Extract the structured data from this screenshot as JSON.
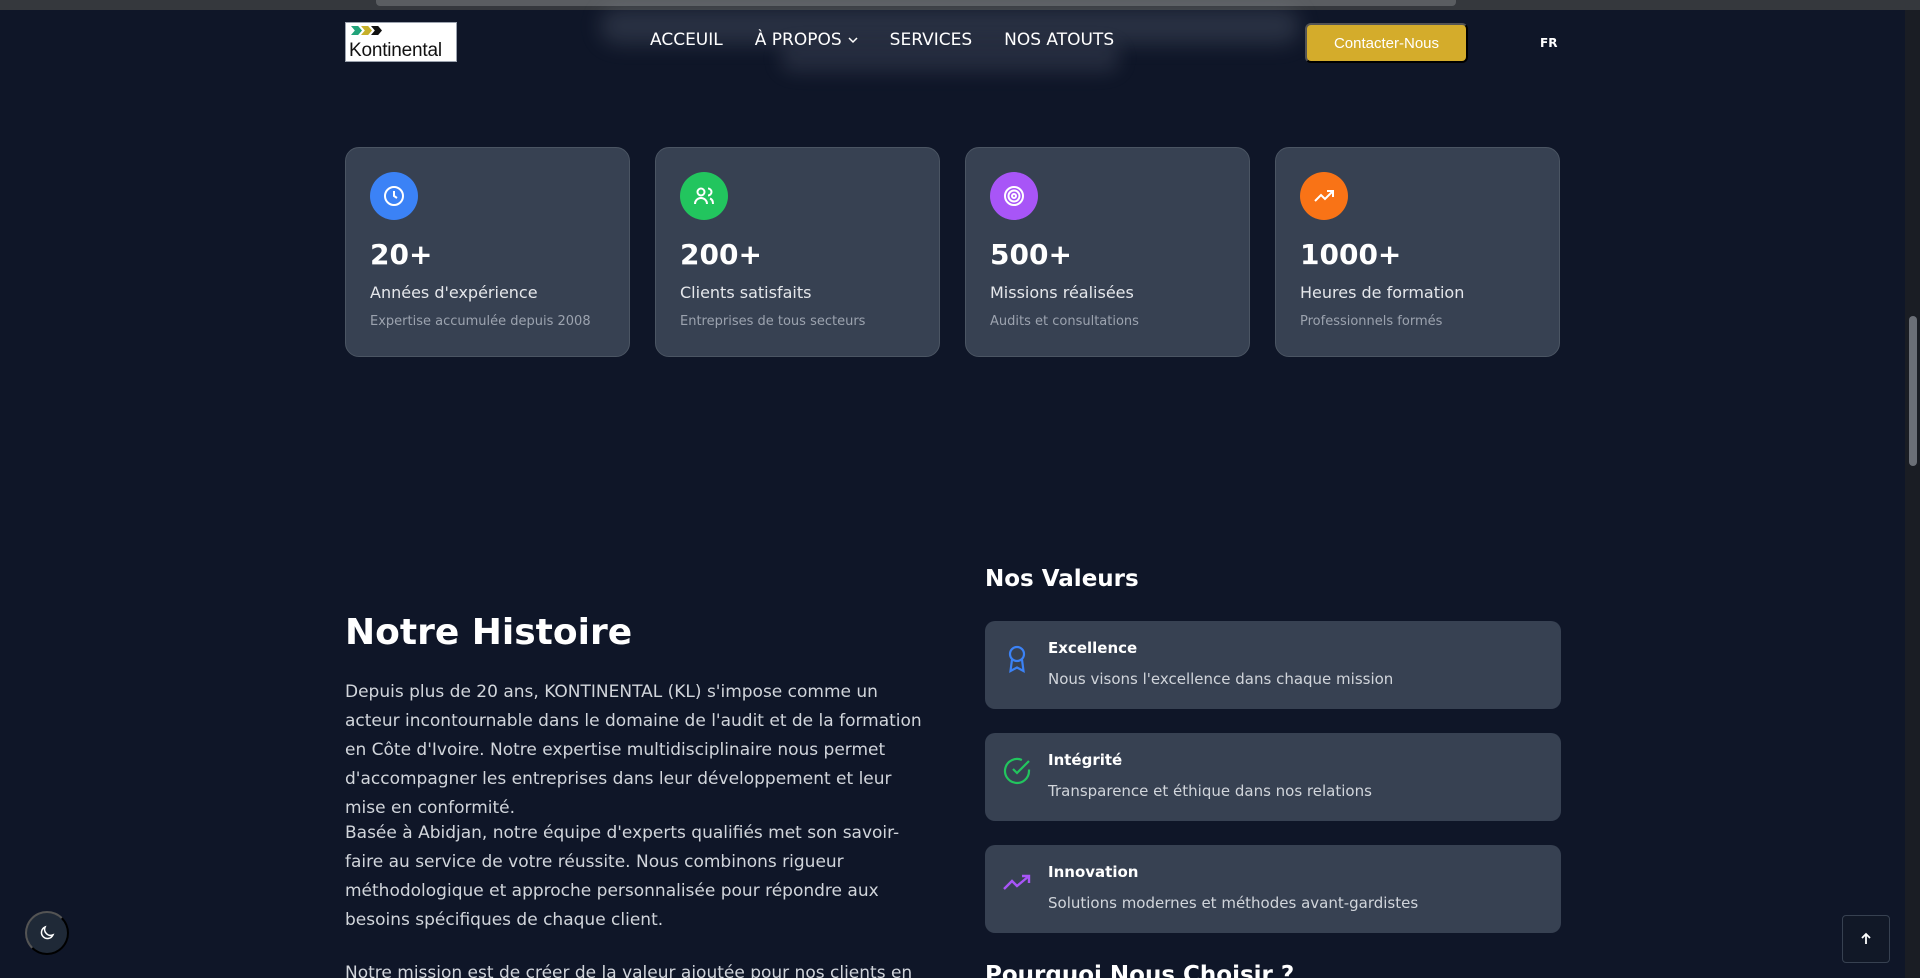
{
  "header": {
    "logo_text": "Kontinental",
    "nav": {
      "accueil": "ACCEUIL",
      "apropos": "À PROPOS",
      "services": "SERVICES",
      "atouts": "NOS ATOUTS"
    },
    "cta_label": "Contacter-Nous",
    "language": "FR"
  },
  "stats": [
    {
      "value": "20+",
      "label": "Années d'expérience",
      "sub": "Expertise accumulée depuis 2008",
      "icon": "clock-icon",
      "color": "#3b82f6"
    },
    {
      "value": "200+",
      "label": "Clients satisfaits",
      "sub": "Entreprises de tous secteurs",
      "icon": "users-icon",
      "color": "#22c55e"
    },
    {
      "value": "500+",
      "label": "Missions réalisées",
      "sub": "Audits et consultations",
      "icon": "target-icon",
      "color": "#a855f7"
    },
    {
      "value": "1000+",
      "label": "Heures de formation",
      "sub": "Professionnels formés",
      "icon": "trending-up-icon",
      "color": "#f97316"
    }
  ],
  "history": {
    "title": "Notre Histoire",
    "paragraphs": [
      "Depuis plus de 20 ans, KONTINENTAL (KL) s'impose comme un acteur incontournable dans le domaine de l'audit et de la formation en Côte d'Ivoire. Notre expertise multidisciplinaire nous permet d'accompagner les entreprises dans leur développement et leur mise en conformité.",
      "Basée à Abidjan, notre équipe d'experts qualifiés met son savoir-faire au service de votre réussite. Nous combinons rigueur méthodologique et approche personnalisée pour répondre aux besoins spécifiques de chaque client.",
      "Notre mission est de créer de la valeur ajoutée pour nos clients en leur"
    ]
  },
  "values": {
    "title": "Nos Valeurs",
    "items": [
      {
        "name": "Excellence",
        "desc": "Nous visons l'excellence dans chaque mission",
        "icon": "award-icon",
        "color": "#3b82f6"
      },
      {
        "name": "Intégrité",
        "desc": "Transparence et éthique dans nos relations",
        "icon": "check-circle-icon",
        "color": "#22c55e"
      },
      {
        "name": "Innovation",
        "desc": "Solutions modernes et méthodes avant-gardistes",
        "icon": "trending-up-icon",
        "color": "#a855f7"
      }
    ]
  },
  "why_title": "Pourquoi Nous Choisir ?",
  "colors": {
    "background": "#0f1628",
    "card": "#374152",
    "accent": "#d4ac2b"
  }
}
